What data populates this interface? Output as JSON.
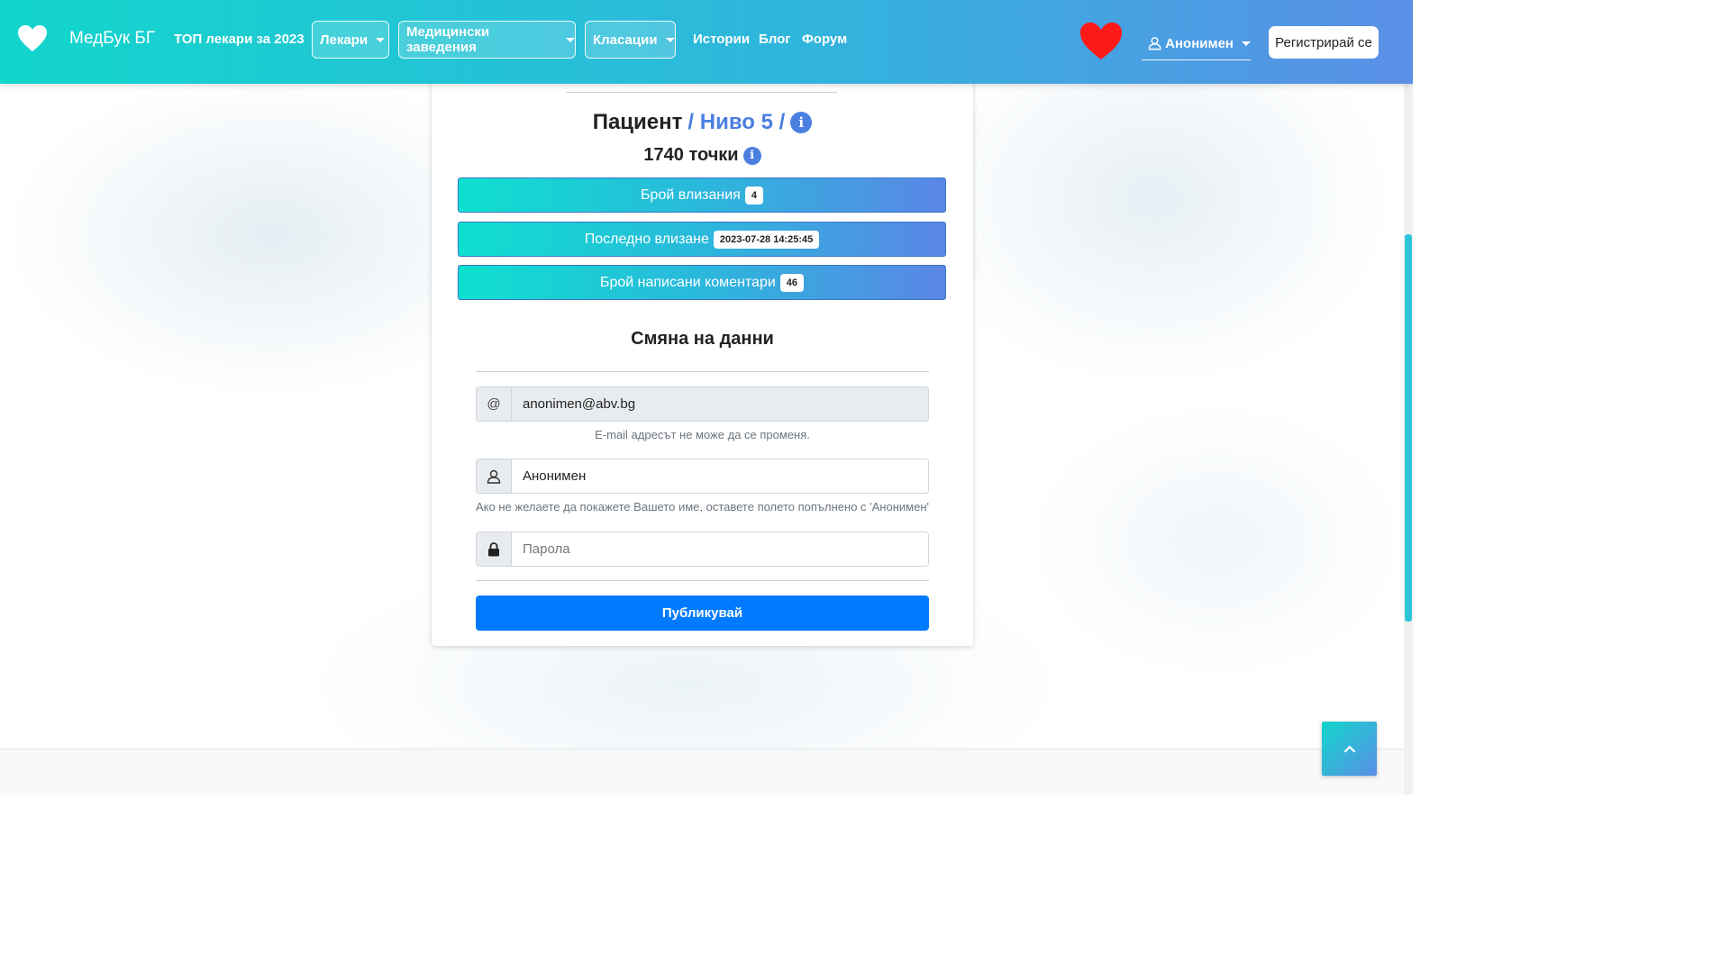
{
  "navbar": {
    "brand": "МедБук БГ",
    "top_doctors": "ТОП лекари за 2023",
    "dropdowns": [
      {
        "label": "Лекари"
      },
      {
        "label": "Медицински заведения"
      },
      {
        "label": "Класации"
      }
    ],
    "links": [
      "Истории",
      "Блог",
      "Форум"
    ],
    "user": "Анонимен",
    "register": "Регистрирай се"
  },
  "profile": {
    "role": "Пациент",
    "level": "/ Ниво 5 /",
    "points": "1740 точки",
    "stats": [
      {
        "label": "Брой влизания",
        "value": "4"
      },
      {
        "label": "Последно влизане",
        "value": "2023-07-28 14:25:45"
      },
      {
        "label": "Брой написани коментари",
        "value": "46"
      }
    ]
  },
  "form": {
    "title": "Смяна на данни",
    "email_prefix": "@",
    "email_value": "anonimen@abv.bg",
    "email_help": "E-mail адресът не може да се променя.",
    "name_value": "Анонимен",
    "name_help": "Ако не желаете да покажете Вашето име, оставете полето попълнено с 'Анонимен'",
    "password_placeholder": "Парола",
    "submit": "Публикувай"
  },
  "colors": {
    "navbar_start": "#12d6cc",
    "navbar_end": "#5a8fe6",
    "accent_blue": "#4a7fe0",
    "primary_button": "#007bff",
    "heart": "#ff1a1a"
  },
  "icons": [
    "heart-icon",
    "user-icon",
    "info-icon",
    "lock-icon",
    "chevron-up-icon"
  ]
}
